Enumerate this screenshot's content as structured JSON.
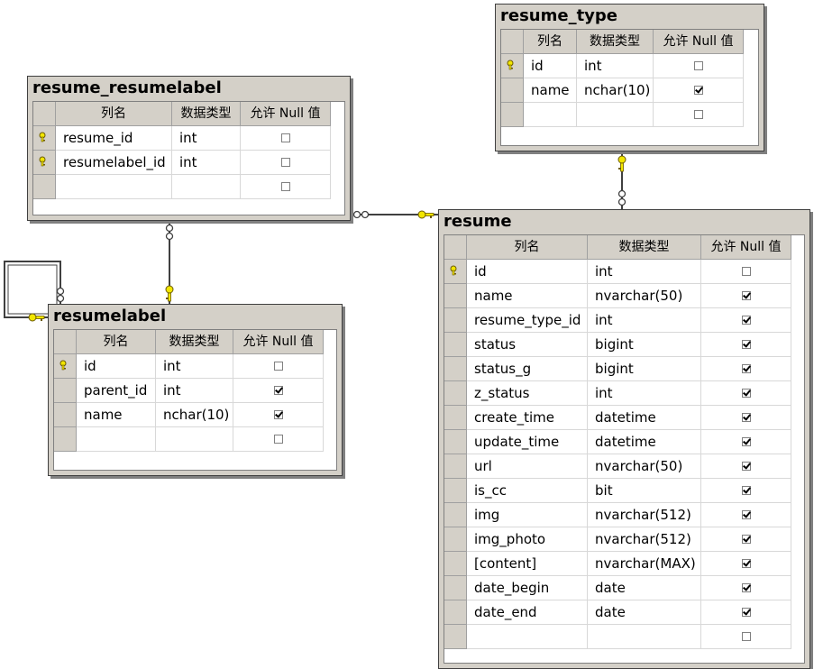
{
  "header_labels": {
    "column_name": "列名",
    "data_type": "数据类型",
    "allow_null": "允许 Null 值"
  },
  "tables": {
    "resume_type": {
      "title": "resume_type",
      "rows": [
        {
          "name": "id",
          "type": "int",
          "nullable": false,
          "key": true
        },
        {
          "name": "name",
          "type": "nchar(10)",
          "nullable": true,
          "key": false
        },
        {
          "name": "",
          "type": "",
          "nullable": false,
          "key": false
        }
      ]
    },
    "resume_resumelabel": {
      "title": "resume_resumelabel",
      "rows": [
        {
          "name": "resume_id",
          "type": "int",
          "nullable": false,
          "key": true
        },
        {
          "name": "resumelabel_id",
          "type": "int",
          "nullable": false,
          "key": true
        },
        {
          "name": "",
          "type": "",
          "nullable": false,
          "key": false
        }
      ]
    },
    "resumelabel": {
      "title": "resumelabel",
      "rows": [
        {
          "name": "id",
          "type": "int",
          "nullable": false,
          "key": true
        },
        {
          "name": "parent_id",
          "type": "int",
          "nullable": true,
          "key": false
        },
        {
          "name": "name",
          "type": "nchar(10)",
          "nullable": true,
          "key": false
        },
        {
          "name": "",
          "type": "",
          "nullable": false,
          "key": false
        }
      ]
    },
    "resume": {
      "title": "resume",
      "rows": [
        {
          "name": "id",
          "type": "int",
          "nullable": false,
          "key": true
        },
        {
          "name": "name",
          "type": "nvarchar(50)",
          "nullable": true,
          "key": false
        },
        {
          "name": "resume_type_id",
          "type": "int",
          "nullable": true,
          "key": false
        },
        {
          "name": "status",
          "type": "bigint",
          "nullable": true,
          "key": false
        },
        {
          "name": "status_g",
          "type": "bigint",
          "nullable": true,
          "key": false
        },
        {
          "name": "z_status",
          "type": "int",
          "nullable": true,
          "key": false
        },
        {
          "name": "create_time",
          "type": "datetime",
          "nullable": true,
          "key": false
        },
        {
          "name": "update_time",
          "type": "datetime",
          "nullable": true,
          "key": false
        },
        {
          "name": "url",
          "type": "nvarchar(50)",
          "nullable": true,
          "key": false
        },
        {
          "name": "is_cc",
          "type": "bit",
          "nullable": true,
          "key": false
        },
        {
          "name": "img",
          "type": "nvarchar(512)",
          "nullable": true,
          "key": false
        },
        {
          "name": "img_photo",
          "type": "nvarchar(512)",
          "nullable": true,
          "key": false
        },
        {
          "name": "[content]",
          "type": "nvarchar(MAX)",
          "nullable": true,
          "key": false
        },
        {
          "name": "date_begin",
          "type": "date",
          "nullable": true,
          "key": false
        },
        {
          "name": "date_end",
          "type": "date",
          "nullable": true,
          "key": false
        },
        {
          "name": "",
          "type": "",
          "nullable": false,
          "key": false
        }
      ]
    }
  },
  "colors": {
    "key_yellow": "#f2e600",
    "key_outline": "#6b5a00",
    "line": "#404040"
  }
}
